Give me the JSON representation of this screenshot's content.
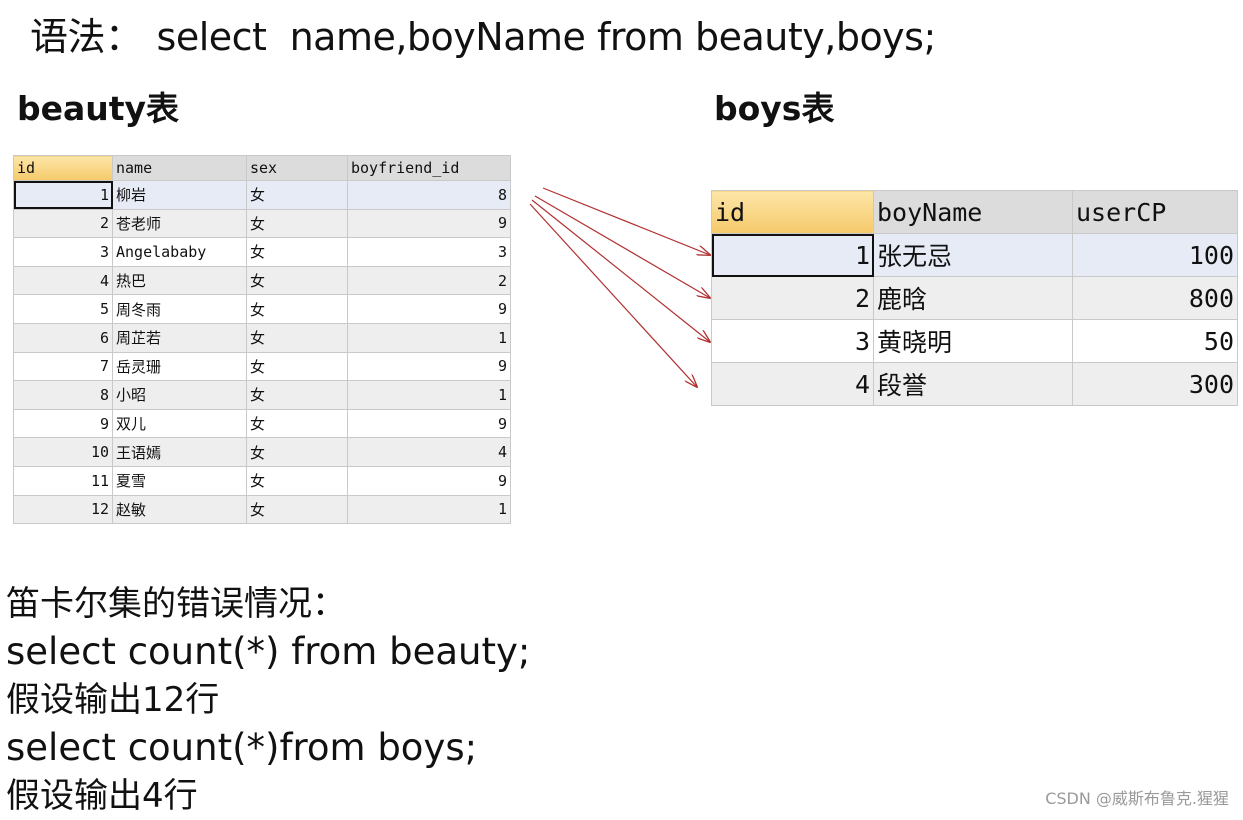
{
  "syntax": {
    "label": "语法：",
    "sql": "select  name,boyName from beauty,boys;"
  },
  "beauty": {
    "title": "beauty表",
    "columns": [
      "id",
      "name",
      "sex",
      "boyfriend_id"
    ],
    "rows": [
      [
        "1",
        "柳岩",
        "女",
        "8"
      ],
      [
        "2",
        "苍老师",
        "女",
        "9"
      ],
      [
        "3",
        "Angelababy",
        "女",
        "3"
      ],
      [
        "4",
        "热巴",
        "女",
        "2"
      ],
      [
        "5",
        "周冬雨",
        "女",
        "9"
      ],
      [
        "6",
        "周芷若",
        "女",
        "1"
      ],
      [
        "7",
        "岳灵珊",
        "女",
        "9"
      ],
      [
        "8",
        "小昭",
        "女",
        "1"
      ],
      [
        "9",
        "双儿",
        "女",
        "9"
      ],
      [
        "10",
        "王语嫣",
        "女",
        "4"
      ],
      [
        "11",
        "夏雪",
        "女",
        "9"
      ],
      [
        "12",
        "赵敏",
        "女",
        "1"
      ]
    ]
  },
  "boys": {
    "title": "boys表",
    "columns": [
      "id",
      "boyName",
      "userCP"
    ],
    "rows": [
      [
        "1",
        "张无忌",
        "100"
      ],
      [
        "2",
        "鹿晗",
        "800"
      ],
      [
        "3",
        "黄晓明",
        "50"
      ],
      [
        "4",
        "段誉",
        "300"
      ]
    ]
  },
  "notes": {
    "heading": "笛卡尔集的错误情况：",
    "line1": "select count(*) from beauty;",
    "line2": "假设输出12行",
    "line3": "select count(*)from boys;",
    "line4": "假设输出4行"
  },
  "arrow_color": "#b03030",
  "watermark": "CSDN @威斯布鲁克.猩猩"
}
